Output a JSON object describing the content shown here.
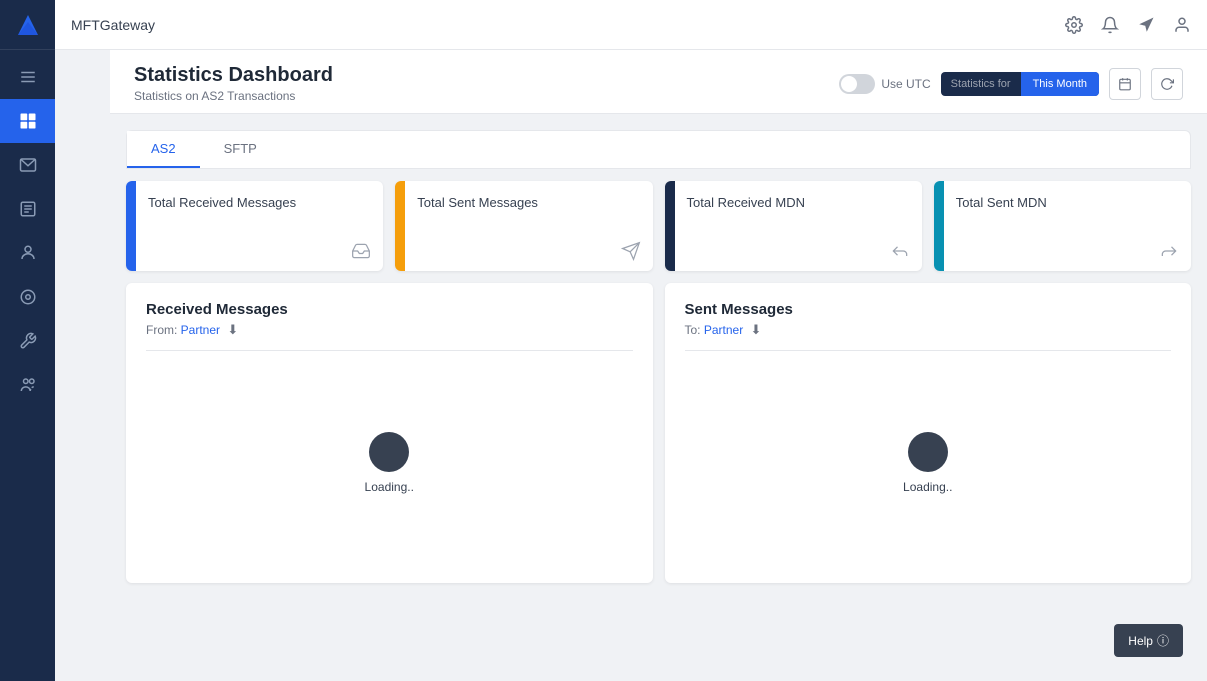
{
  "app": {
    "name": "MFTGateway"
  },
  "topbar": {
    "settings_icon": "gear",
    "notifications_icon": "bell",
    "navigation_icon": "location-arrow",
    "user_icon": "user-circle"
  },
  "page": {
    "title": "Statistics Dashboard",
    "subtitle": "Statistics on AS2 Transactions",
    "use_utc_label": "Use UTC",
    "stats_for_label": "Statistics for",
    "stats_for_value": "This Month",
    "calendar_icon": "calendar",
    "refresh_icon": "refresh"
  },
  "tabs": [
    {
      "id": "as2",
      "label": "AS2",
      "active": true
    },
    {
      "id": "sftp",
      "label": "SFTP",
      "active": false
    }
  ],
  "stat_cards": [
    {
      "id": "total-received",
      "title": "Total Received Messages",
      "bar_color": "blue",
      "icon": "inbox"
    },
    {
      "id": "total-sent",
      "title": "Total Sent Messages",
      "bar_color": "yellow",
      "icon": "send"
    },
    {
      "id": "total-received-mdn",
      "title": "Total Received MDN",
      "bar_color": "dark",
      "icon": "reply"
    },
    {
      "id": "total-sent-mdn",
      "title": "Total Sent MDN",
      "bar_color": "teal",
      "icon": "forward"
    }
  ],
  "charts": [
    {
      "id": "received-messages",
      "title": "Received Messages",
      "sub_label": "From:",
      "sub_value": "Partner",
      "loading": true,
      "loading_text": "Loading.."
    },
    {
      "id": "sent-messages",
      "title": "Sent Messages",
      "sub_label": "To:",
      "sub_value": "Partner",
      "loading": true,
      "loading_text": "Loading.."
    }
  ],
  "help": {
    "label": "Help"
  },
  "sidebar": {
    "items": [
      {
        "id": "dashboard",
        "icon": "chart-bar",
        "active": true
      },
      {
        "id": "messages",
        "icon": "envelope",
        "active": false
      },
      {
        "id": "transactions",
        "icon": "list",
        "active": false
      },
      {
        "id": "users",
        "icon": "user",
        "active": false
      },
      {
        "id": "settings",
        "icon": "settings",
        "active": false
      },
      {
        "id": "tools",
        "icon": "wrench",
        "active": false
      },
      {
        "id": "partners",
        "icon": "users",
        "active": false
      }
    ]
  }
}
